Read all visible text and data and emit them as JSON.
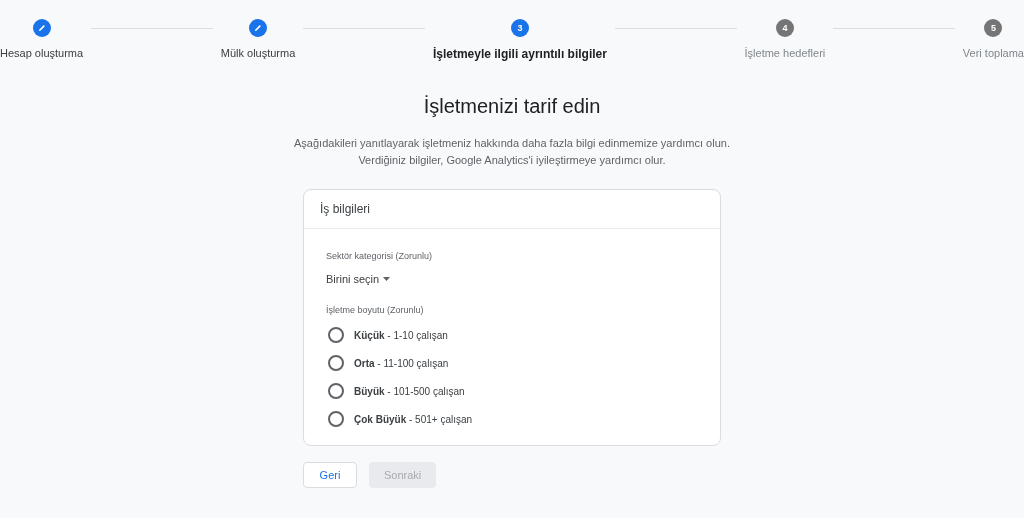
{
  "steps": [
    {
      "kind": "done",
      "label": "Hesap oluşturma"
    },
    {
      "kind": "done",
      "label": "Mülk oluşturma"
    },
    {
      "kind": "current",
      "number": "3",
      "label": "İşletmeyle ilgili ayrıntılı bilgiler"
    },
    {
      "kind": "todo",
      "number": "4",
      "label": "İşletme hedefleri"
    },
    {
      "kind": "todo",
      "number": "5",
      "label": "Veri toplama"
    }
  ],
  "heading": "İşletmenizi tarif edin",
  "intro": [
    "Aşağıdakileri yanıtlayarak işletmeniz hakkında daha fazla bilgi edinmemize yardımcı olun.",
    "Verdiğiniz bilgiler, Google Analytics'i iyileştirmeye yardımcı olur."
  ],
  "card": {
    "title": "İş bilgileri",
    "category": {
      "label": "Sektör kategorisi (Zorunlu)",
      "value": "Birini seçin"
    },
    "size": {
      "label": "İşletme boyutu (Zorunlu)",
      "options": [
        {
          "text": "**Küçük** - 1-10 çalışan",
          "selected": false
        },
        {
          "text": "**Orta** - 11-100 çalışan",
          "selected": false
        },
        {
          "text": "**Büyük** - 101-500 çalışan",
          "selected": false
        },
        {
          "text": "**Çok Büyük** - 501+ çalışan",
          "selected": false
        }
      ]
    }
  },
  "buttons": {
    "back": {
      "label": "Geri",
      "disabled": false
    },
    "next": {
      "label": "Sonraki",
      "disabled": true
    }
  }
}
